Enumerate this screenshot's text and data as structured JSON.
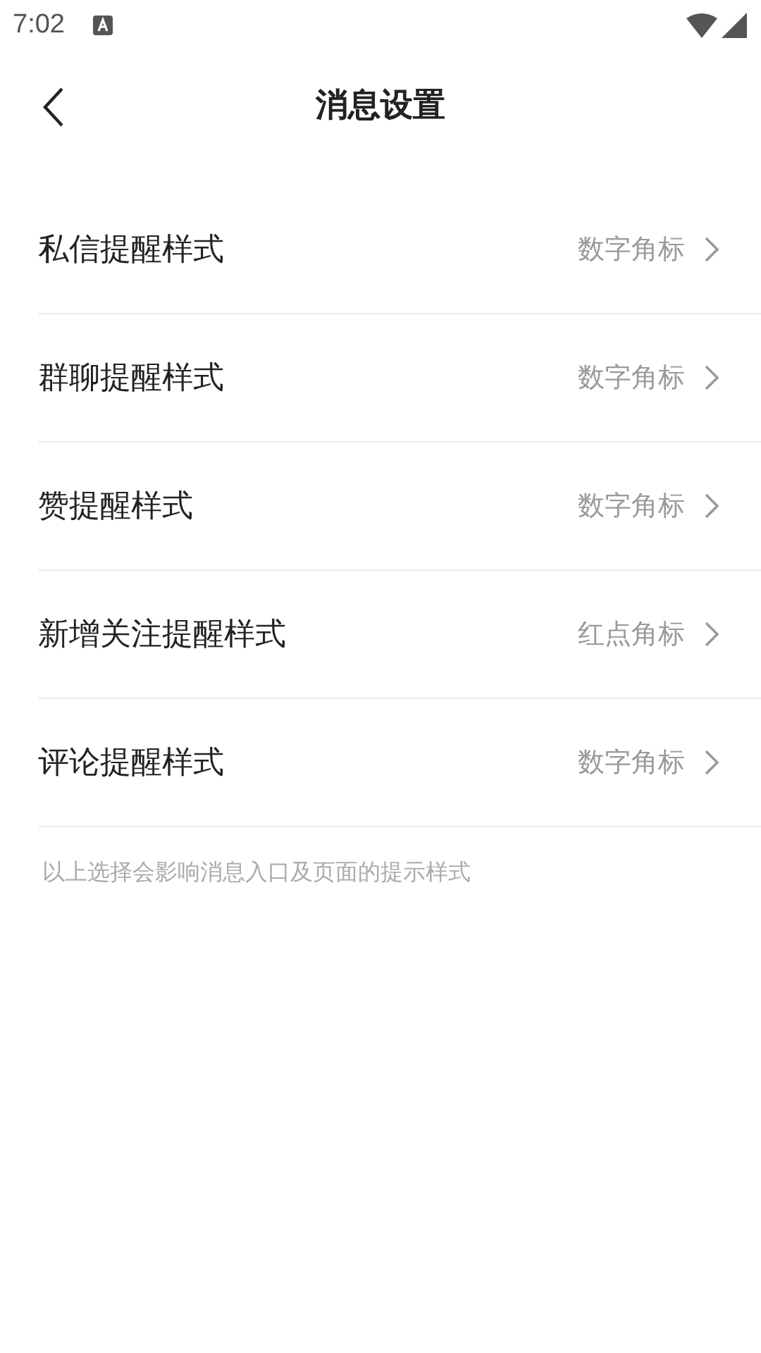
{
  "status_bar": {
    "time": "7:02"
  },
  "header": {
    "title": "消息设置"
  },
  "settings": [
    {
      "label": "私信提醒样式",
      "value": "数字角标"
    },
    {
      "label": "群聊提醒样式",
      "value": "数字角标"
    },
    {
      "label": "赞提醒样式",
      "value": "数字角标"
    },
    {
      "label": "新增关注提醒样式",
      "value": "红点角标"
    },
    {
      "label": "评论提醒样式",
      "value": "数字角标"
    }
  ],
  "footnote": "以上选择会影响消息入口及页面的提示样式"
}
